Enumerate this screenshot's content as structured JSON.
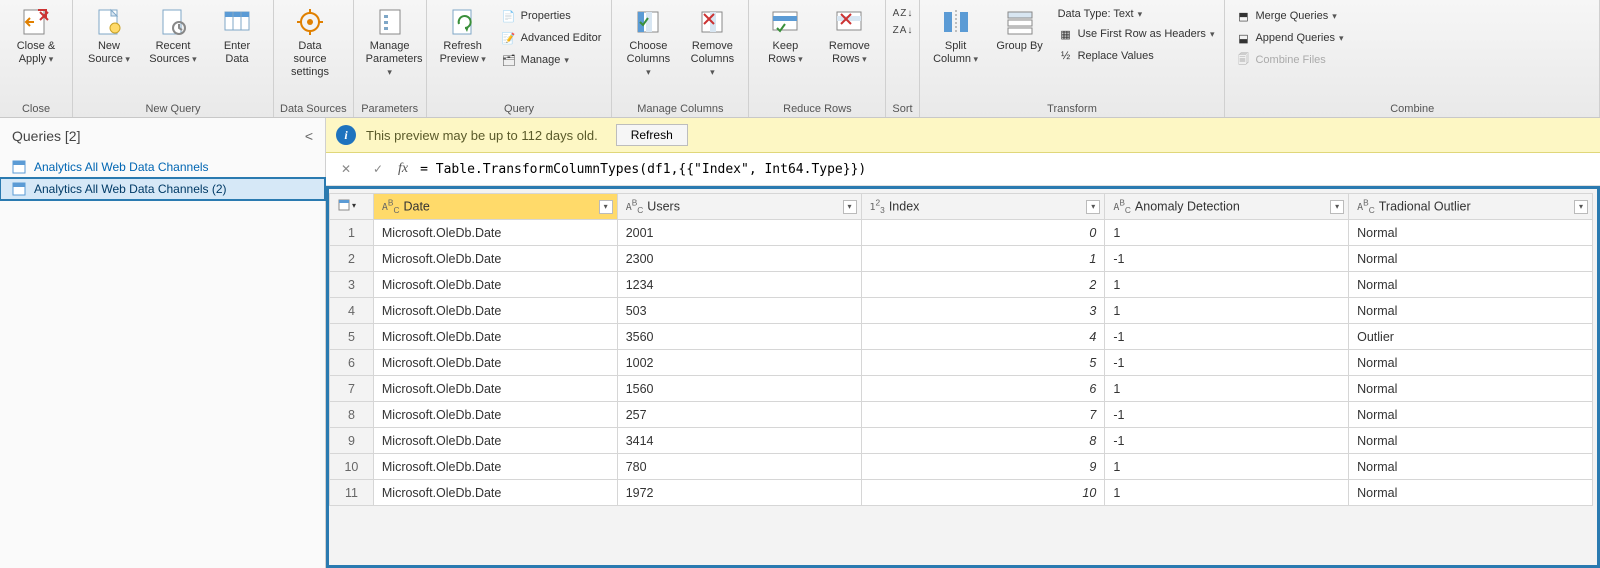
{
  "ribbon": {
    "close": {
      "close_apply": "Close &\nApply",
      "group": "Close"
    },
    "newquery": {
      "new_source": "New\nSource",
      "recent_sources": "Recent\nSources",
      "enter_data": "Enter\nData",
      "group": "New Query"
    },
    "datasources": {
      "data_source_settings": "Data source\nsettings",
      "group": "Data Sources"
    },
    "parameters": {
      "manage_parameters": "Manage\nParameters",
      "group": "Parameters"
    },
    "query": {
      "refresh_preview": "Refresh\nPreview",
      "properties": "Properties",
      "advanced_editor": "Advanced Editor",
      "manage": "Manage",
      "group": "Query"
    },
    "managecols": {
      "choose_columns": "Choose\nColumns",
      "remove_columns": "Remove\nColumns",
      "group": "Manage Columns"
    },
    "reducerows": {
      "keep_rows": "Keep\nRows",
      "remove_rows": "Remove\nRows",
      "group": "Reduce Rows"
    },
    "sort": {
      "group": "Sort"
    },
    "transform": {
      "split_column": "Split\nColumn",
      "group_by": "Group\nBy",
      "data_type": "Data Type: Text",
      "first_row_headers": "Use First Row as Headers",
      "replace_values": "Replace Values",
      "group": "Transform"
    },
    "combine": {
      "merge_queries": "Merge Queries",
      "append_queries": "Append Queries",
      "combine_files": "Combine Files",
      "group": "Combine"
    }
  },
  "queries": {
    "header": "Queries [2]",
    "items": [
      {
        "name": "Analytics All Web Data Channels"
      },
      {
        "name": "Analytics All Web Data Channels (2)"
      }
    ]
  },
  "notice": {
    "text": "This preview may be up to 112 days old.",
    "refresh": "Refresh"
  },
  "formula": "= Table.TransformColumnTypes(df1,{{\"Index\", Int64.Type}})",
  "table": {
    "columns": [
      {
        "name": "Date",
        "type": "ABC"
      },
      {
        "name": "Users",
        "type": "ABC"
      },
      {
        "name": "Index",
        "type": "123"
      },
      {
        "name": "Anomaly Detection",
        "type": "ABC"
      },
      {
        "name": "Tradional Outlier",
        "type": "ABC"
      }
    ],
    "rows": [
      {
        "n": 1,
        "date": "Microsoft.OleDb.Date",
        "users": "2001",
        "index": 0,
        "anomaly": "1",
        "outlier": "Normal"
      },
      {
        "n": 2,
        "date": "Microsoft.OleDb.Date",
        "users": "2300",
        "index": 1,
        "anomaly": "-1",
        "outlier": "Normal"
      },
      {
        "n": 3,
        "date": "Microsoft.OleDb.Date",
        "users": "1234",
        "index": 2,
        "anomaly": "1",
        "outlier": "Normal"
      },
      {
        "n": 4,
        "date": "Microsoft.OleDb.Date",
        "users": "503",
        "index": 3,
        "anomaly": "1",
        "outlier": "Normal"
      },
      {
        "n": 5,
        "date": "Microsoft.OleDb.Date",
        "users": "3560",
        "index": 4,
        "anomaly": "-1",
        "outlier": "Outlier"
      },
      {
        "n": 6,
        "date": "Microsoft.OleDb.Date",
        "users": "1002",
        "index": 5,
        "anomaly": "-1",
        "outlier": "Normal"
      },
      {
        "n": 7,
        "date": "Microsoft.OleDb.Date",
        "users": "1560",
        "index": 6,
        "anomaly": "1",
        "outlier": "Normal"
      },
      {
        "n": 8,
        "date": "Microsoft.OleDb.Date",
        "users": "257",
        "index": 7,
        "anomaly": "-1",
        "outlier": "Normal"
      },
      {
        "n": 9,
        "date": "Microsoft.OleDb.Date",
        "users": "3414",
        "index": 8,
        "anomaly": "-1",
        "outlier": "Normal"
      },
      {
        "n": 10,
        "date": "Microsoft.OleDb.Date",
        "users": "780",
        "index": 9,
        "anomaly": "1",
        "outlier": "Normal"
      },
      {
        "n": 11,
        "date": "Microsoft.OleDb.Date",
        "users": "1972",
        "index": 10,
        "anomaly": "1",
        "outlier": "Normal"
      }
    ]
  }
}
